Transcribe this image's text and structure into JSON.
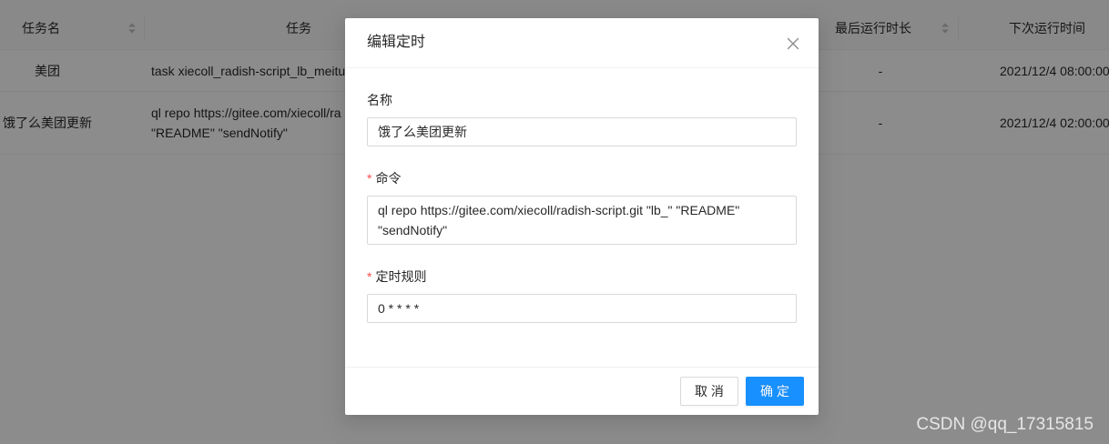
{
  "table": {
    "columns": [
      {
        "label": "任务名",
        "sortable": true
      },
      {
        "label": "任务"
      },
      {
        "label": "最后运行时长",
        "sortable": true
      },
      {
        "label": "下次运行时间"
      }
    ],
    "rows": [
      {
        "name": "美团",
        "command_lines": [
          "task xiecoll_radish-script_lb_meitua"
        ],
        "last_run_duration": "-",
        "next_run_time": "2021/12/4 08:00:00"
      },
      {
        "name": "饿了么美团更新",
        "command_lines": [
          "ql repo https://gitee.com/xiecoll/ra",
          "\"README\" \"sendNotify\""
        ],
        "last_run_duration": "-",
        "next_run_time": "2021/12/4 02:00:00"
      }
    ]
  },
  "modal": {
    "title": "编辑定时",
    "required_mark": "*",
    "fields": {
      "name": {
        "label": "名称",
        "required": false,
        "value": "饿了么美团更新"
      },
      "command": {
        "label": "命令",
        "required": true,
        "value": "ql repo https://gitee.com/xiecoll/radish-script.git \"lb_\" \"README\" \"sendNotify\""
      },
      "schedule": {
        "label": "定时规则",
        "required": true,
        "value": "0 * * * *"
      }
    },
    "buttons": {
      "cancel": "取 消",
      "ok": "确 定"
    }
  },
  "watermark": "CSDN @qq_17315815",
  "icons": {
    "close": "close-icon",
    "sort": "sort-icon"
  },
  "colors": {
    "primary": "#1890ff",
    "required_mark": "#ff4d4f"
  }
}
